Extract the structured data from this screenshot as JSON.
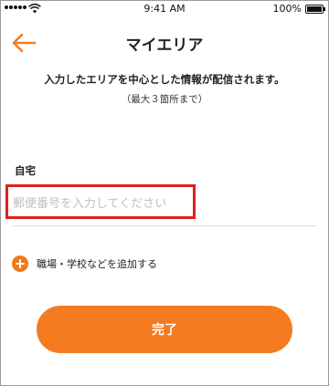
{
  "status_bar": {
    "time": "9:41 AM",
    "battery_percent": "100%",
    "battery_level": 1.0
  },
  "header": {
    "back_icon": "arrow-left-icon",
    "title": "マイエリア"
  },
  "description": "入力したエリアを中心とした情報が配信されます。",
  "sub_description": "（最大３箇所まで）",
  "home_field": {
    "label": "自宅",
    "value": "",
    "placeholder": "郵便番号を入力してください"
  },
  "add_area": {
    "icon": "plus-circle-icon",
    "label": "職場・学校などを追加する"
  },
  "done_button": {
    "label": "完了"
  },
  "colors": {
    "accent": "#f47b20",
    "highlight": "#e02020",
    "placeholder": "#c0c0c0"
  }
}
